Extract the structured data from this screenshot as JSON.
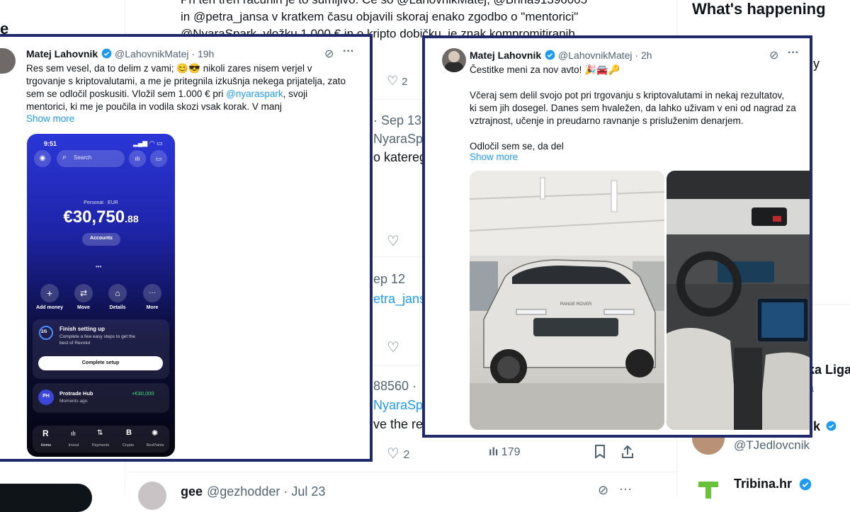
{
  "background_feed": {
    "top_line_1": "Pri teh treh računih je to sumljivo. Ce so @LahovnikMatej, @Bhna91396005",
    "top_line_2": "in @petra_jansa v kratkem času objavili skoraj enako zgodbo o \"mentorici\"",
    "top_line_3": "@NyaraSpark, vložku 1.000 € in o kripto dobičku, je znak kompromitiranih",
    "like_count_1": "2",
    "partial_date_1": "· Sep 13",
    "partial_handle_1": "NyaraSp",
    "partial_word_1": "o kateregi",
    "partial_date_2": "ep 12",
    "partial_handle_2": "etra_jans",
    "partial_number_3": "88560 ·",
    "partial_handle_3": "NyaraSp",
    "partial_word_3": "ve the re",
    "like_count_bottom": "2",
    "views_bottom": "179",
    "bottom_user_name": "gee",
    "bottom_user_handle": "@gezhodder · Jul 23",
    "left_edge_char": "e"
  },
  "right_sidebar": {
    "heading": "What's happening",
    "partial_y": "y",
    "partial_liga": "ka Liga",
    "partial_a": "a",
    "partial_k": "k",
    "follow_handle": "@TJedlovcnik",
    "tribina_name": "Tribina.hr"
  },
  "left_tweet": {
    "name": "Matej Lahovnik",
    "handle": "@LahovnikMatej · 19h",
    "text_1": "Res sem vesel, da to delim z vami; 😊😎 nikoli zares nisem verjel v",
    "text_2": "trgovanje s kriptovalutami, a me je pritegnila izkušnja nekega prijatelja, zato",
    "text_3_before": "sem se odločil poskusiti. Vložil sem 1.000 € pri ",
    "text_3_link": "@nyaraspark",
    "text_3_after": ", svoji",
    "text_4": "mentorici, ki me je poučila in vodila skozi vsak korak. V manj",
    "show_more": "Show more"
  },
  "phone": {
    "time": "9:51",
    "search_placeholder": "Search",
    "account_label": "Personal · EUR",
    "balance_main": "€30,750",
    "balance_cents": ".88",
    "accounts_btn": "Accounts",
    "actions": [
      "Add money",
      "Move",
      "Details",
      "More"
    ],
    "setup_progress": "2/5",
    "setup_title": "Finish setting up",
    "setup_desc_1": "Complete a few easy steps to get the",
    "setup_desc_2": "best of Revolut",
    "setup_button": "Complete setup",
    "hub_initials": "PH",
    "hub_name": "Protrade Hub",
    "hub_amount": "+€30,000",
    "hub_time": "Moments ago",
    "nav": [
      "Home",
      "Invest",
      "Payments",
      "Crypto",
      "RevPoints"
    ]
  },
  "right_tweet": {
    "name": "Matej Lahovnik",
    "handle": "@LahovnikMatej · 2h",
    "line_1": "Čestitke meni za nov avto! 🎉🚘🔑",
    "para_1": "Včeraj sem delil svojo pot pri trgovanju s kriptovalutami in nekaj rezultatov,",
    "para_2": "ki sem jih dosegel. Danes sem hvaležen, da lahko uživam v eni od nagrad za",
    "para_3": "vztrajnost, učenje in preudarno ravnanje s prisluženim denarjem.",
    "para_4": "Odločil sem se, da del",
    "show_more": "Show more",
    "car_badge": "RANGE ROVER"
  },
  "colors": {
    "card_border": "#202a6b",
    "link": "#1d9bf0",
    "verified": "#1d9bf0"
  }
}
